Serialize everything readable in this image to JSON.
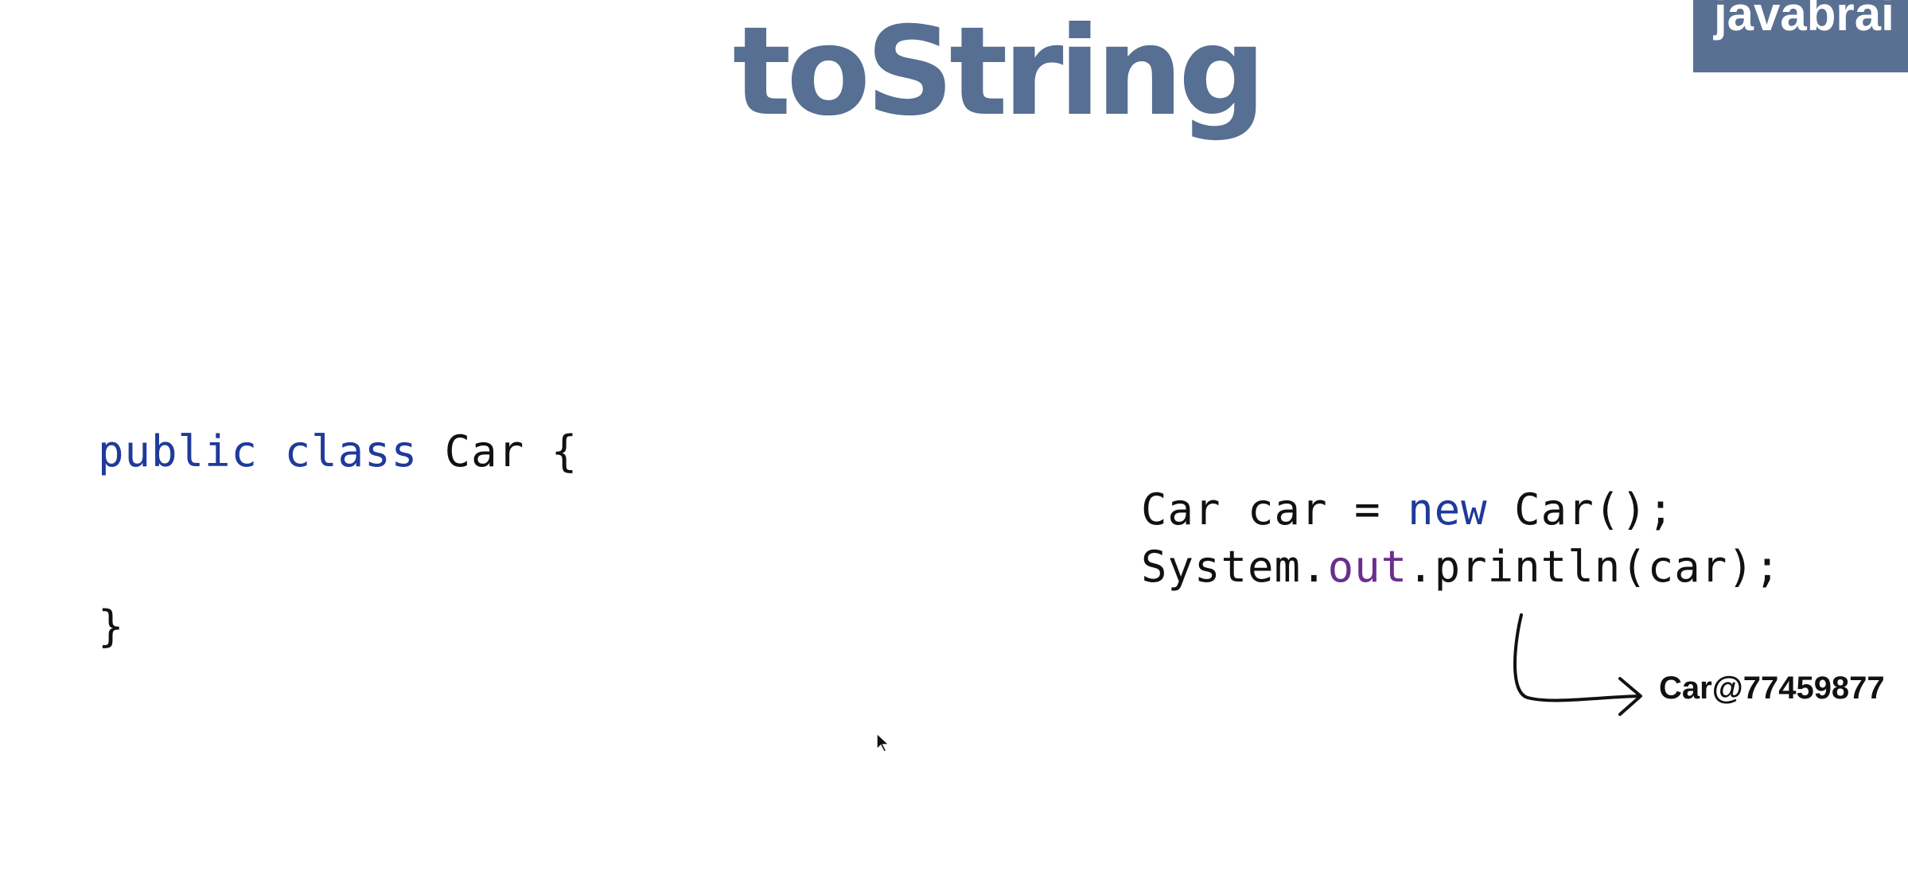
{
  "slide": {
    "title": "toString",
    "brand": "javabrai"
  },
  "code_left": {
    "line1": {
      "kw1": "public",
      "sp1": " ",
      "kw2": "class",
      "rest": " Car {"
    },
    "line2": "}"
  },
  "code_right": {
    "line1": {
      "pre": "Car car = ",
      "kw": "new",
      "post": " Car();"
    },
    "line2": {
      "pre": "System.",
      "field": "out",
      "post": ".println(car);"
    }
  },
  "output": {
    "text": "Car@77459877"
  },
  "colors": {
    "title": "#566f92",
    "brand_bg": "#5a7092",
    "keyword": "#1f3a9b",
    "field": "#6b2e8e"
  },
  "icons": {
    "arrow": "curved-arrow-icon",
    "cursor": "mouse-cursor-icon"
  }
}
